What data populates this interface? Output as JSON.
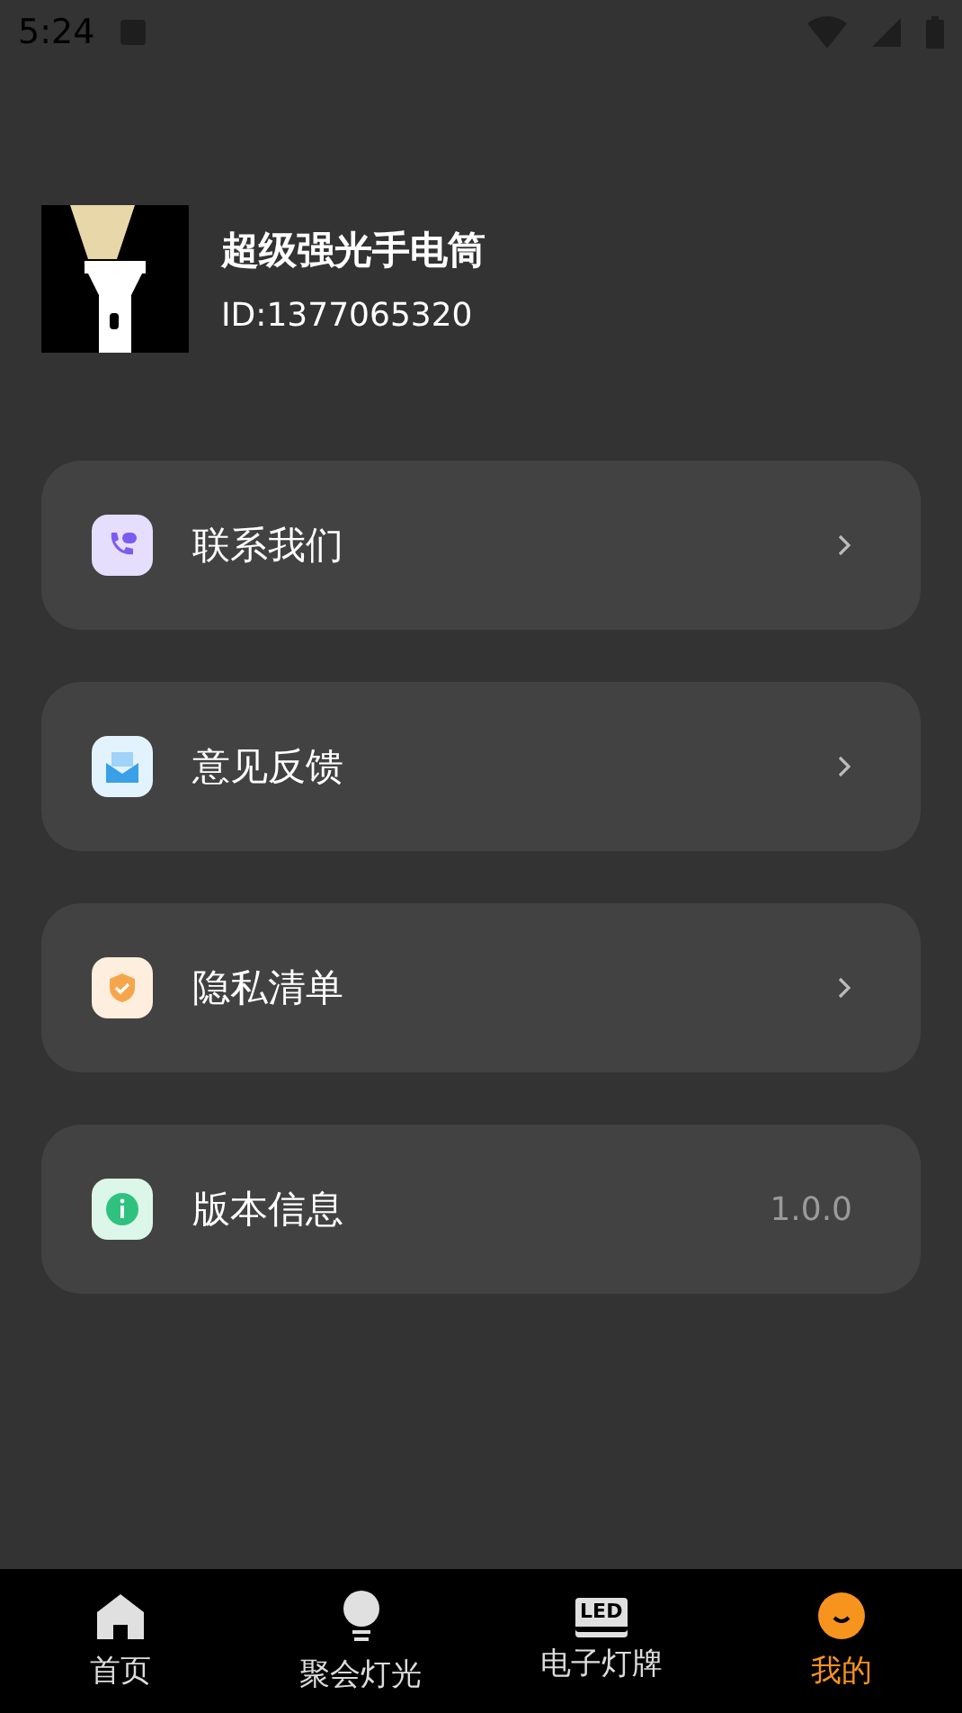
{
  "status_bar": {
    "time": "5:24"
  },
  "profile": {
    "name": "超级强光手电筒",
    "id": "ID:1377065320"
  },
  "menu": [
    {
      "label": "联系我们",
      "kind": "link"
    },
    {
      "label": "意见反馈",
      "kind": "link"
    },
    {
      "label": "隐私清单",
      "kind": "link"
    },
    {
      "label": "版本信息",
      "kind": "value",
      "value": "1.0.0"
    }
  ],
  "tabs": [
    {
      "label": "首页",
      "selected": false
    },
    {
      "label": "聚会灯光",
      "selected": false
    },
    {
      "label": "电子灯牌",
      "icon_text": "LED",
      "selected": false
    },
    {
      "label": "我的",
      "selected": true
    }
  ]
}
